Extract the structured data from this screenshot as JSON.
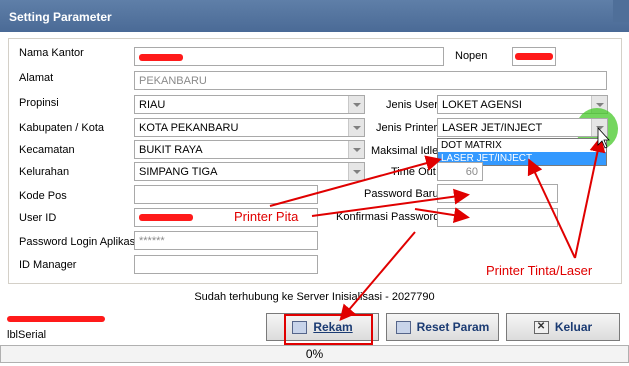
{
  "window": {
    "title": "Setting Parameter"
  },
  "form": {
    "nama_kantor_label": "Nama Kantor",
    "nopen_label": "Nopen",
    "alamat_label": "Alamat",
    "alamat_value": "PEKANBARU",
    "propinsi_label": "Propinsi",
    "propinsi_value": "RIAU",
    "kabupaten_label": "Kabupaten / Kota",
    "kabupaten_value": "KOTA PEKANBARU",
    "kecamatan_label": "Kecamatan",
    "kecamatan_value": "BUKIT RAYA",
    "kelurahan_label": "Kelurahan",
    "kelurahan_value": "SIMPANG TIGA",
    "kode_pos_label": "Kode Pos",
    "user_id_label": "User ID",
    "password_login_label": "Password Login Aplikasi",
    "password_login_value": "******",
    "id_manager_label": "ID Manager",
    "jenis_user_label": "Jenis User",
    "jenis_user_value": "LOKET AGENSI",
    "jenis_printer_label": "Jenis Printer",
    "jenis_printer_value": "LASER JET/INJECT",
    "maksimal_label": "Maksimal Idle",
    "time_out_label": "Time Out",
    "time_out_value": "60",
    "password_baru_label": "Password Baru",
    "konfirmasi_label": "Konfirmasi Password"
  },
  "printer_dropdown": {
    "options": [
      "DOT MATRIX",
      "LASER JET/INJECT"
    ],
    "selected": "LASER JET/INJECT"
  },
  "status": {
    "server_text": "Sudah terhubung ke Server Inisialisasi - 2027790",
    "serial_label": "lblSerial"
  },
  "buttons": {
    "rekam": "Rekam",
    "reset": "Reset Param",
    "keluar": "Keluar"
  },
  "progress": {
    "value": 0,
    "label": "0%"
  },
  "annotations": {
    "printer_pita": "Printer Pita",
    "printer_tinta": "Printer Tinta/Laser",
    "color": "#e00000"
  }
}
